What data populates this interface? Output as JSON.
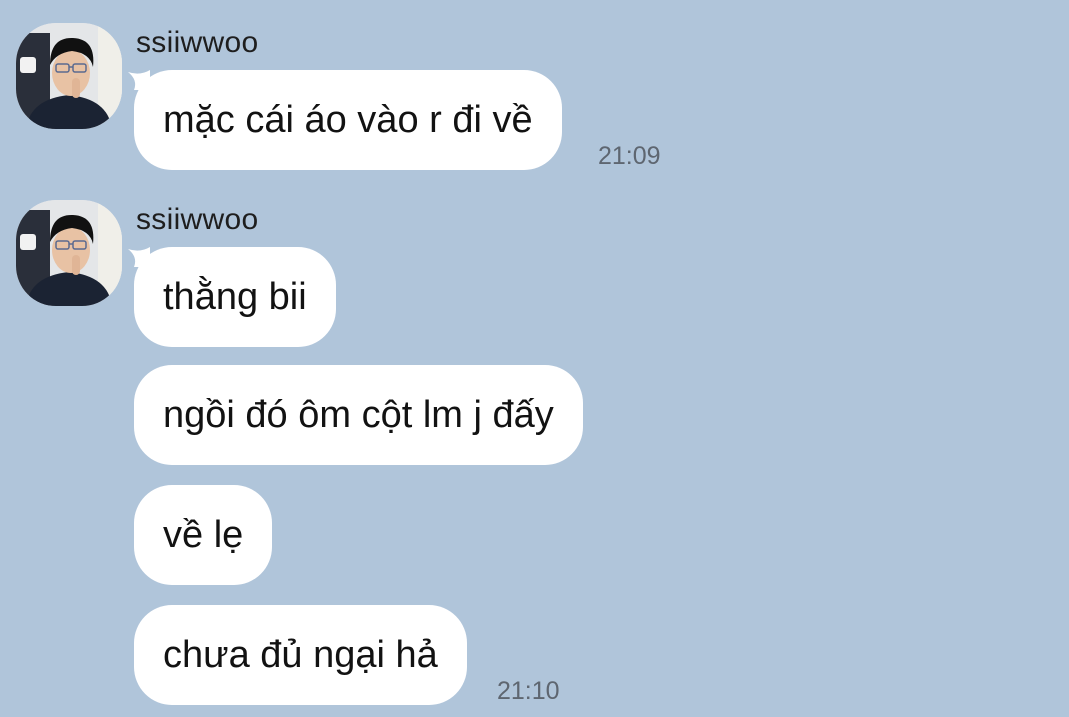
{
  "colors": {
    "background": "#b0c5da",
    "bubble": "#ffffff",
    "text": "#121212",
    "time": "#5e6670"
  },
  "groups": [
    {
      "sender": "ssiiwwoo",
      "avatar_icon": "profile-photo-icon",
      "messages": [
        {
          "text": "mặc cái áo vào r đi về",
          "time": "21:09"
        }
      ]
    },
    {
      "sender": "ssiiwwoo",
      "avatar_icon": "profile-photo-icon",
      "messages": [
        {
          "text": "thằng bii",
          "time": ""
        },
        {
          "text": "ngồi đó ôm cột lm j đấy",
          "time": ""
        },
        {
          "text": "về lẹ",
          "time": ""
        },
        {
          "text": "chưa đủ ngại hả",
          "time": "21:10"
        }
      ]
    }
  ]
}
